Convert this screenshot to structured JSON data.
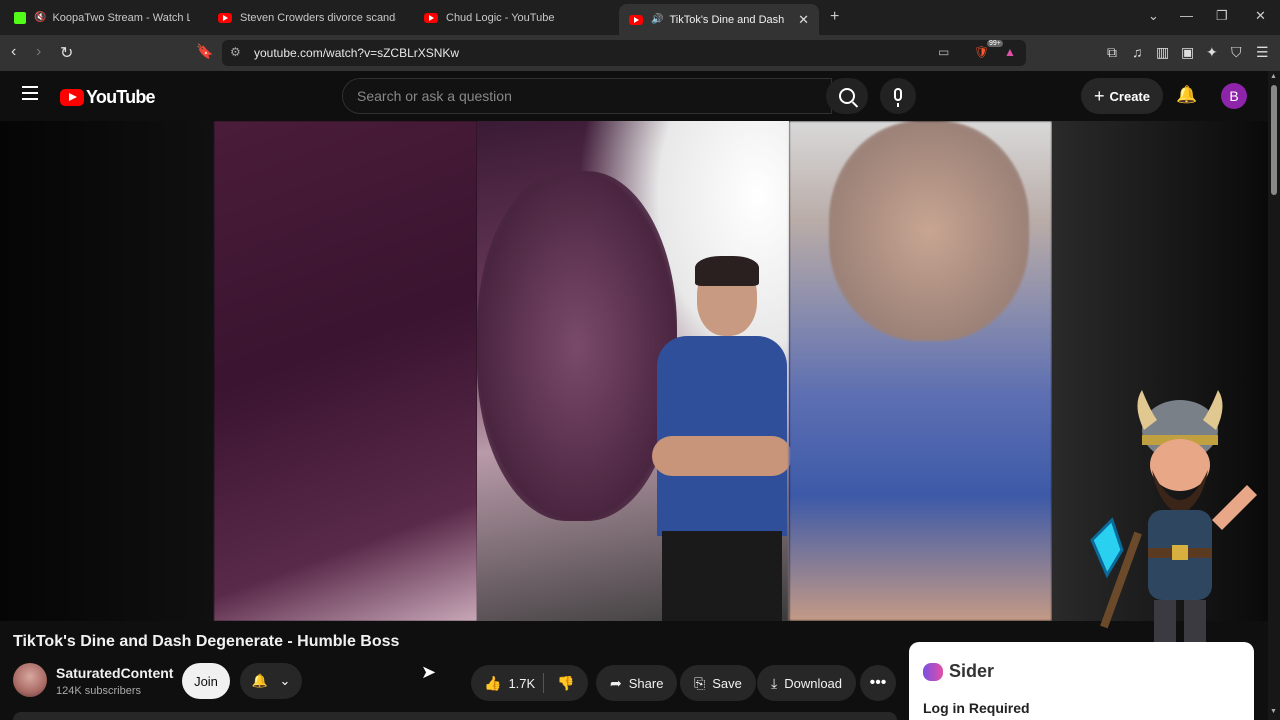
{
  "browser": {
    "tabs": [
      {
        "title": "KoopaTwo Stream - Watch Live o",
        "favicon": "kick-icon",
        "muted": true
      },
      {
        "title": "Steven Crowders divorce scandal | RE",
        "favicon": "youtube-icon"
      },
      {
        "title": "Chud Logic - YouTube",
        "favicon": "youtube-icon"
      },
      {
        "title": "TikTok's Dine and Dash Degen",
        "favicon": "youtube-icon",
        "audio": true,
        "active": true
      }
    ],
    "url": "youtube.com/watch?v=sZCBLrXSNKw",
    "extension_badge": "99+"
  },
  "youtube": {
    "logo_text": "YouTube",
    "search_placeholder": "Search or ask a question",
    "create_label": "Create",
    "avatar_letter": "B"
  },
  "video": {
    "title": "TikTok's Dine and Dash Degenerate - Humble Boss",
    "channel": "SaturatedContent",
    "subscribers": "124K subscribers",
    "join_label": "Join",
    "likes": "1.7K",
    "share_label": "Share",
    "save_label": "Save",
    "download_label": "Download"
  },
  "sider": {
    "brand": "Sider",
    "message": "Log in Required"
  },
  "colors": {
    "background": "#0f0f0f",
    "youtube_red": "#ff0000",
    "pill": "#272727",
    "avatar": "#8e24aa"
  }
}
